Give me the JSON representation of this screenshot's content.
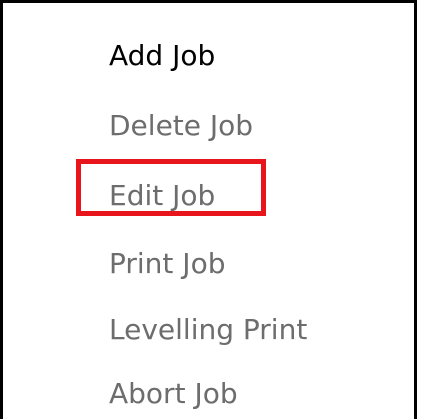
{
  "menu": {
    "items": [
      {
        "label": "Add Job"
      },
      {
        "label": "Delete Job"
      },
      {
        "label": "Edit Job"
      },
      {
        "label": "Print Job"
      },
      {
        "label": "Levelling Print"
      },
      {
        "label": "Abort Job"
      }
    ],
    "highlighted_item": "Edit Job"
  },
  "colors": {
    "highlight_border": "#e8161c",
    "active_text": "#000000",
    "inactive_text": "#6d6d6d",
    "frame_border": "#000000"
  }
}
